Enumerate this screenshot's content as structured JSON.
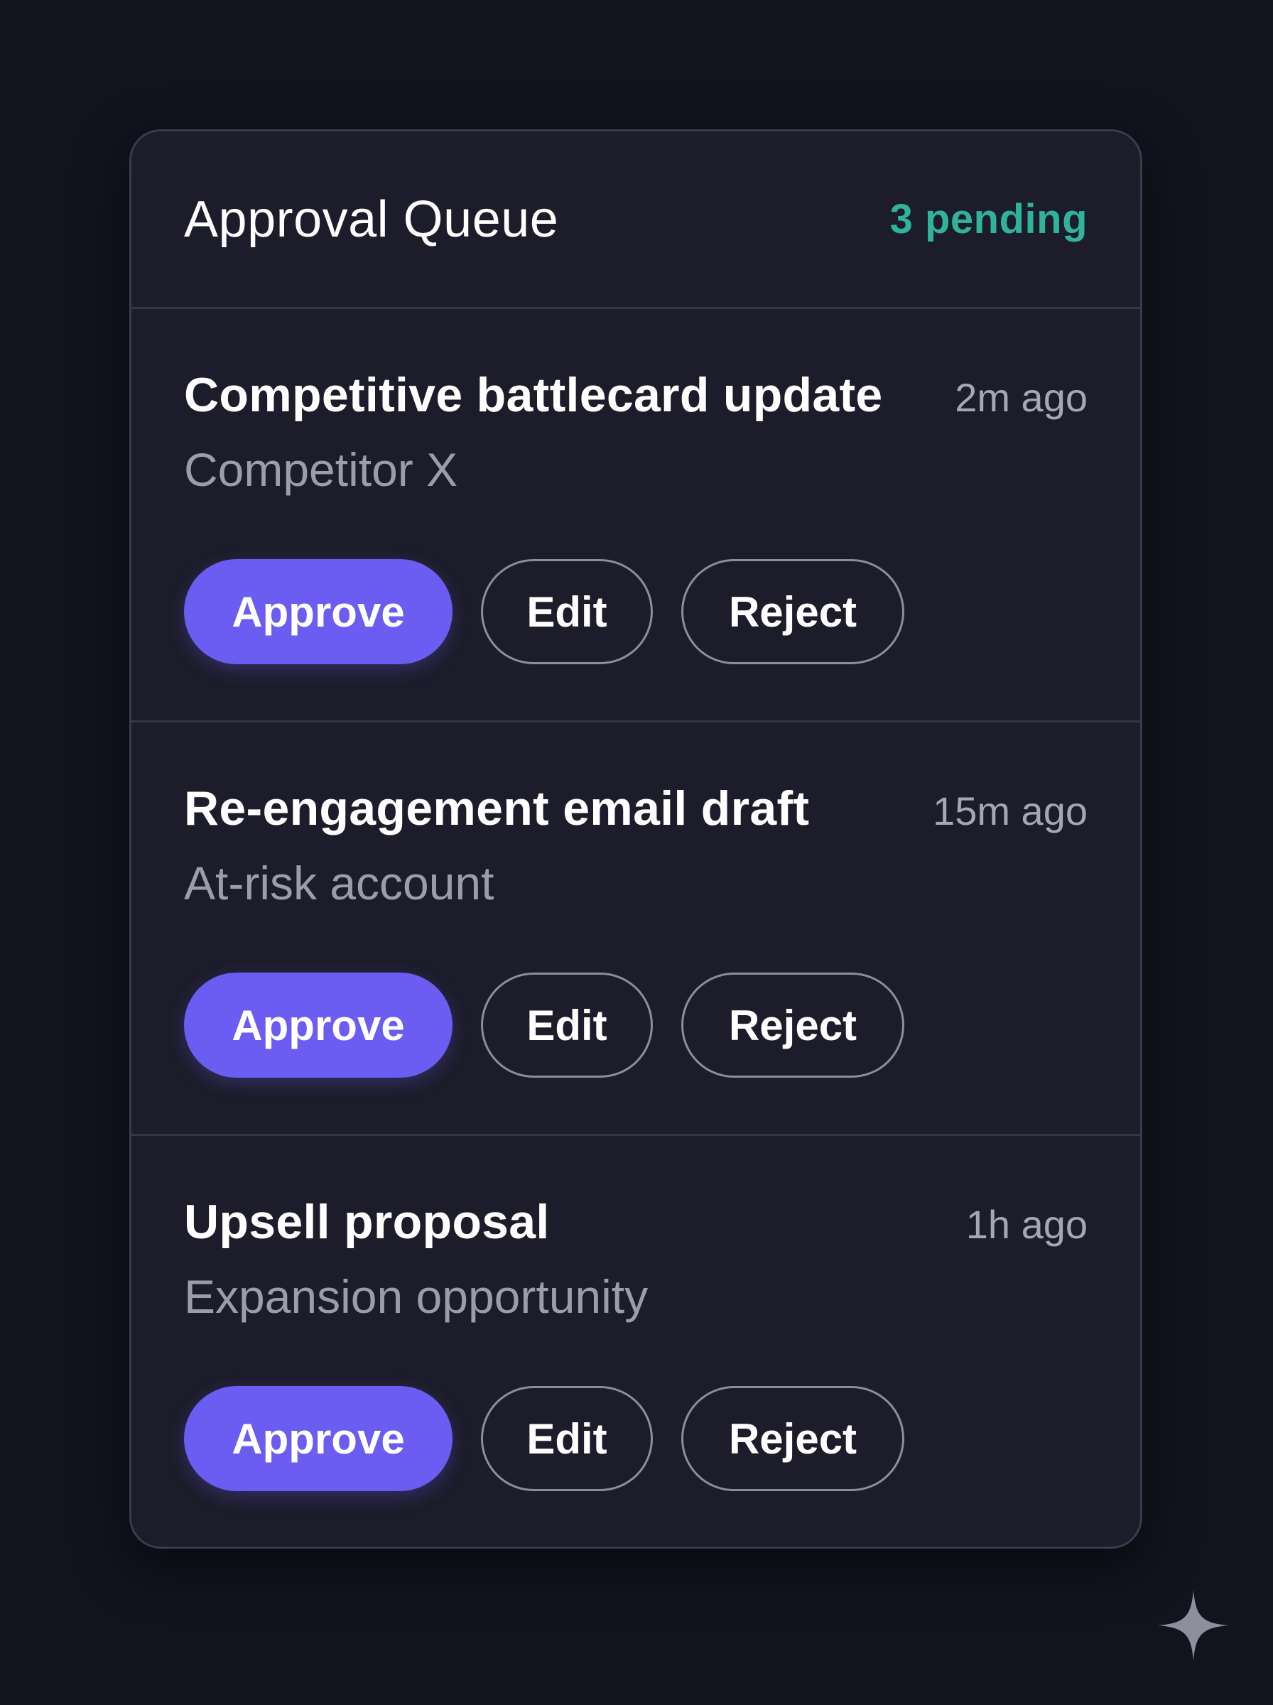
{
  "header": {
    "title": "Approval Queue",
    "pending": "3 pending"
  },
  "items": [
    {
      "title": "Competitive battlecard update",
      "time": "2m ago",
      "subtitle": "Competitor X",
      "actions": {
        "approve": "Approve",
        "edit": "Edit",
        "reject": "Reject"
      }
    },
    {
      "title": "Re-engagement email draft",
      "time": "15m ago",
      "subtitle": "At-risk account",
      "actions": {
        "approve": "Approve",
        "edit": "Edit",
        "reject": "Reject"
      }
    },
    {
      "title": "Upsell proposal",
      "time": "1h ago",
      "subtitle": "Expansion opportunity",
      "actions": {
        "approve": "Approve",
        "edit": "Edit",
        "reject": "Reject"
      }
    }
  ],
  "colors": {
    "background": "#131320",
    "card": "#1c1c2a",
    "accent": "#6b5cf2",
    "pending": "#2fb39a"
  },
  "icons": {
    "corner": "sparkle-icon"
  }
}
